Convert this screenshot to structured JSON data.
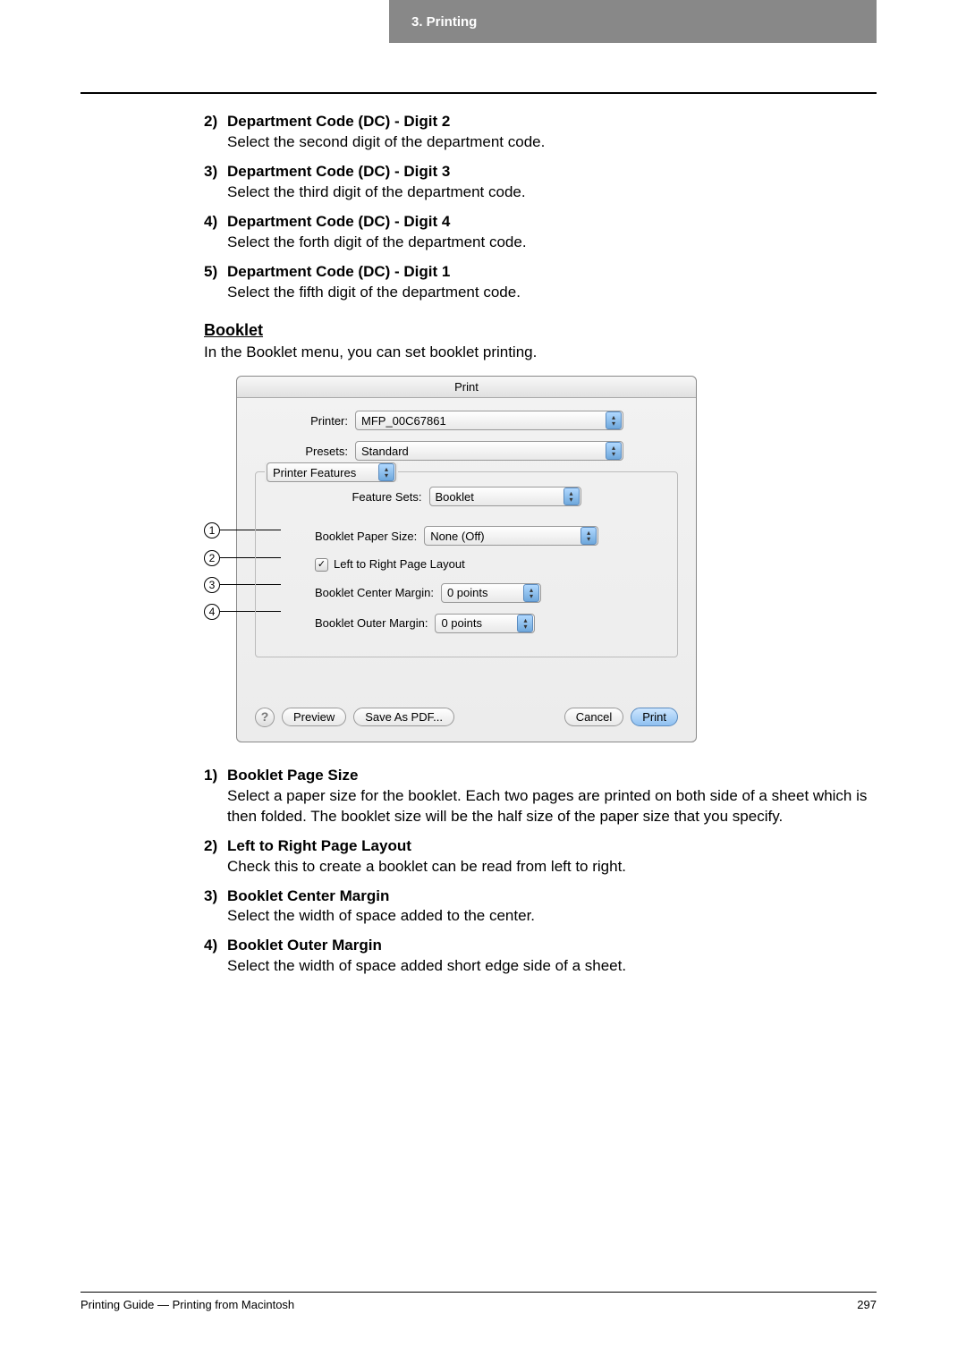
{
  "header": {
    "tab": "3.  Printing"
  },
  "dc_items": [
    {
      "num": "2)",
      "title": "Department Code (DC) - Digit 2",
      "desc": "Select the second digit of the department code."
    },
    {
      "num": "3)",
      "title": "Department Code (DC) - Digit 3",
      "desc": "Select the third digit of the department code."
    },
    {
      "num": "4)",
      "title": "Department Code (DC) - Digit 4",
      "desc": "Select the forth digit of the department code."
    },
    {
      "num": "5)",
      "title": "Department Code (DC) - Digit 1",
      "desc": "Select the fifth digit of the department code."
    }
  ],
  "section": {
    "heading": "Booklet",
    "sub": "In the Booklet menu, you can set booklet printing."
  },
  "dialog": {
    "title": "Print",
    "printer_label": "Printer:",
    "printer_value": "MFP_00C67861",
    "presets_label": "Presets:",
    "presets_value": "Standard",
    "panel_value": "Printer Features",
    "feature_sets_label": "Feature Sets:",
    "feature_sets_value": "Booklet",
    "paper_size_label": "Booklet Paper Size:",
    "paper_size_value": "None (Off)",
    "ltr_checked": "✓",
    "ltr_label": "Left to Right Page Layout",
    "center_margin_label": "Booklet Center Margin:",
    "center_margin_value": "0 points",
    "outer_margin_label": "Booklet Outer Margin:",
    "outer_margin_value": "0 points",
    "help": "?",
    "preview": "Preview",
    "save_pdf": "Save As PDF...",
    "cancel": "Cancel",
    "print": "Print"
  },
  "callout_nums": {
    "c1": "1",
    "c2": "2",
    "c3": "3",
    "c4": "4"
  },
  "booklet_items": [
    {
      "num": "1)",
      "title": "Booklet Page Size",
      "desc": "Select a paper size for the booklet.  Each two pages are printed on both side of a sheet which is then folded.  The booklet size will be the half size of the paper size that you specify."
    },
    {
      "num": "2)",
      "title": "Left to Right Page Layout",
      "desc": "Check this to create a booklet can be read from left to right."
    },
    {
      "num": "3)",
      "title": "Booklet Center Margin",
      "desc": "Select the width of space added to the center."
    },
    {
      "num": "4)",
      "title": "Booklet Outer Margin",
      "desc": "Select the width of space added short edge side of a sheet."
    }
  ],
  "footer": {
    "left": "Printing Guide — Printing from Macintosh",
    "right": "297"
  }
}
